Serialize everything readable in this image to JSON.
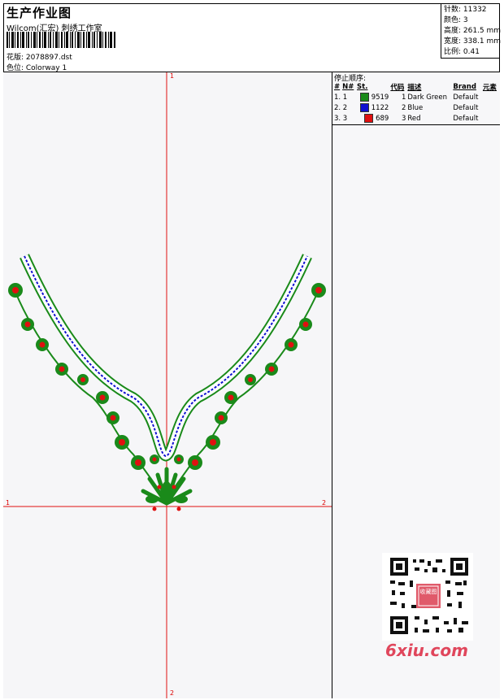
{
  "header": {
    "title": "生产作业图",
    "company": "Wilcom(汇宏) 刺绣工作室",
    "design_label": "花版: 2078897.dst",
    "colorway_label": "色位: Colorway 1"
  },
  "stats": {
    "stitches": "针数: 11332",
    "colors": "颜色: 3",
    "height": "高度: 261.5 mm",
    "width": "宽度: 338.1 mm",
    "scale": "比例: 0.41"
  },
  "stop_sequence": {
    "title": "停止顺序:",
    "columns": [
      "#",
      "N#",
      "St.",
      "代码",
      "描述",
      "Brand",
      "元素"
    ],
    "rows": [
      {
        "num": "1. 1",
        "color": "#1a8a1a",
        "st": "9519",
        "code": "1",
        "desc": "Dark Green",
        "brand": "Default"
      },
      {
        "num": "2. 2",
        "color": "#1010d0",
        "st": "1122",
        "code": "2",
        "desc": "Blue",
        "brand": "Default"
      },
      {
        "num": "3. 3",
        "color": "#e01010",
        "st": "689",
        "code": "3",
        "desc": "Red",
        "brand": "Default"
      }
    ]
  },
  "axes": {
    "top_label": "1",
    "bottom_label": "2",
    "left_label": "1",
    "right_label": "2"
  },
  "watermark": {
    "site": "6xiu.com",
    "stamp_text": "收藏图"
  },
  "colors": {
    "axis": "#e01010",
    "green": "#1a8a1a",
    "blue": "#1010d0",
    "red": "#e01010",
    "brand_pink": "#e0465c"
  }
}
